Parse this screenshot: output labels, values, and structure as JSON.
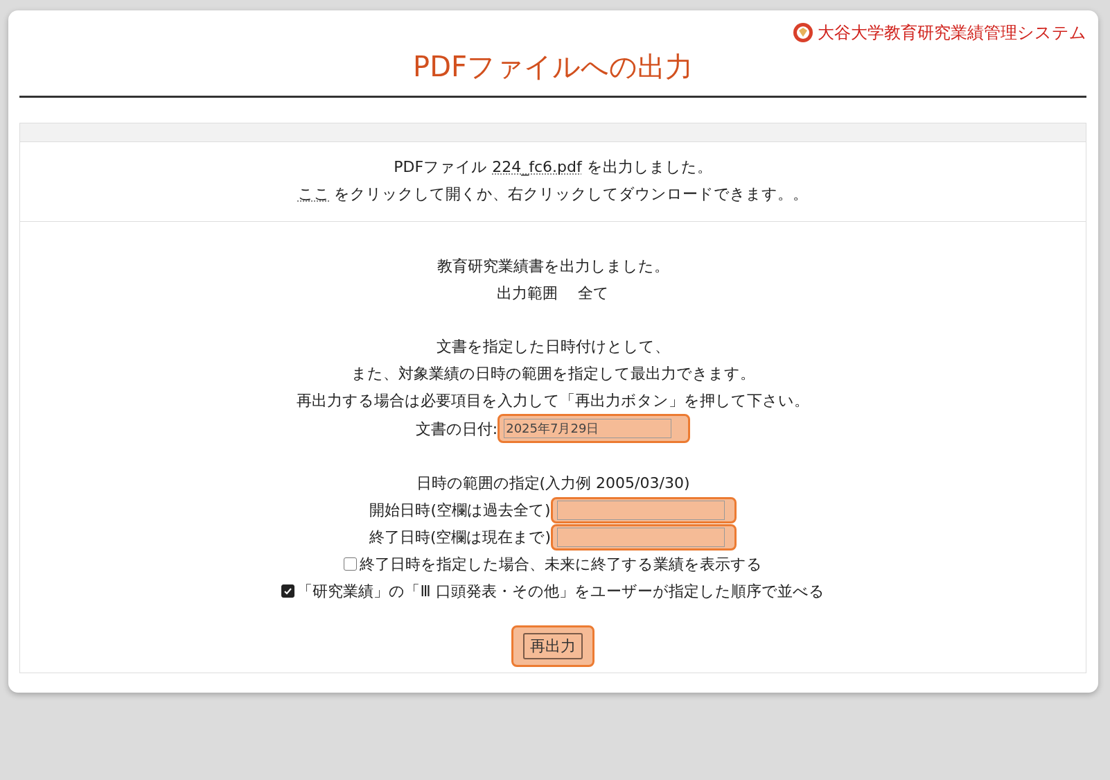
{
  "header": {
    "system_name": "大谷大学教育研究業績管理システム",
    "title": "PDFファイルへの出力"
  },
  "message": {
    "line1": {
      "before": "PDFファイル ",
      "link": "224_fc6.pdf",
      "after": " を出力しました。"
    },
    "line2": {
      "link": "ここ",
      "after": " をクリックして開くか、右クリックしてダウンロードできます。。"
    }
  },
  "result": {
    "lines": [
      "教育研究業績書を出力しました。",
      "出力範囲　 全て"
    ]
  },
  "instructions": [
    "文書を指定した日時付けとして、",
    "また、対象業績の日時の範囲を指定して最出力できます。",
    "再出力する場合は必要項目を入力して「再出力ボタン」を押して下さい。"
  ],
  "doc_date": {
    "label": "文書の日付:",
    "value": "2025年7月29日",
    "highlighted": true
  },
  "range_heading": "日時の範囲の指定(入力例 2005/03/30)",
  "range_fields": [
    {
      "label": "開始日時(空欄は過去全て)",
      "highlighted": true
    },
    {
      "label": "終了日時(空欄は現在まで)",
      "highlighted": true
    }
  ],
  "options": [
    {
      "label": "終了日時を指定した場合、未来に終了する業績を表示する",
      "checked": false
    },
    {
      "label": "「研究業績」の「Ⅲ 口頭発表・その他」をユーザーが指定した順序で並べる",
      "checked": true
    }
  ],
  "submit": {
    "label": "再出力",
    "highlighted": true
  }
}
